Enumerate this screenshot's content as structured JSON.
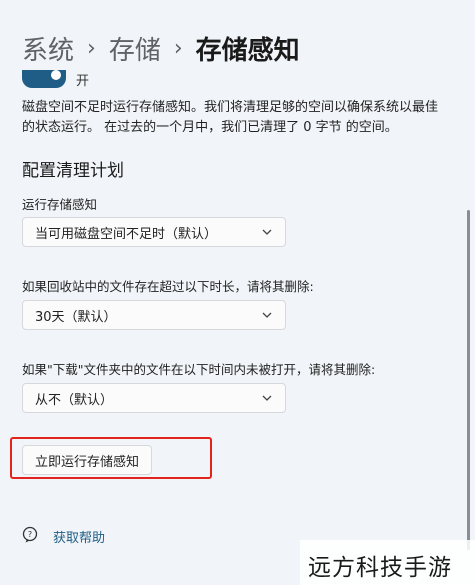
{
  "breadcrumb": {
    "items": [
      "系统",
      "存储"
    ],
    "separator": "›",
    "current": "存储感知"
  },
  "toggle": {
    "state_label": "开",
    "on": true
  },
  "description": "磁盘空间不足时运行存储感知。我们将清理足够的空间以确保系统以最佳的状态运行。 在过去的一个月中，我们已清理了 0 字节 的空间。",
  "config": {
    "section_title": "配置清理计划",
    "run_label": "运行存储感知",
    "run_value": "当可用磁盘空间不足时（默认）",
    "recycle_label": "如果回收站中的文件存在超过以下时长，请将其删除:",
    "recycle_value": "30天（默认）",
    "downloads_label": "如果\"下载\"文件夹中的文件在以下时间内未被打开，请将其删除:",
    "downloads_value": "从不（默认）",
    "run_now_label": "立即运行存储感知"
  },
  "help": {
    "label": "获取帮助",
    "icon": "help-chat-icon"
  },
  "watermark": "远方科技手游",
  "colors": {
    "accent": "#1f5d86",
    "highlight": "#e3241c",
    "background": "#f1f4f8"
  }
}
